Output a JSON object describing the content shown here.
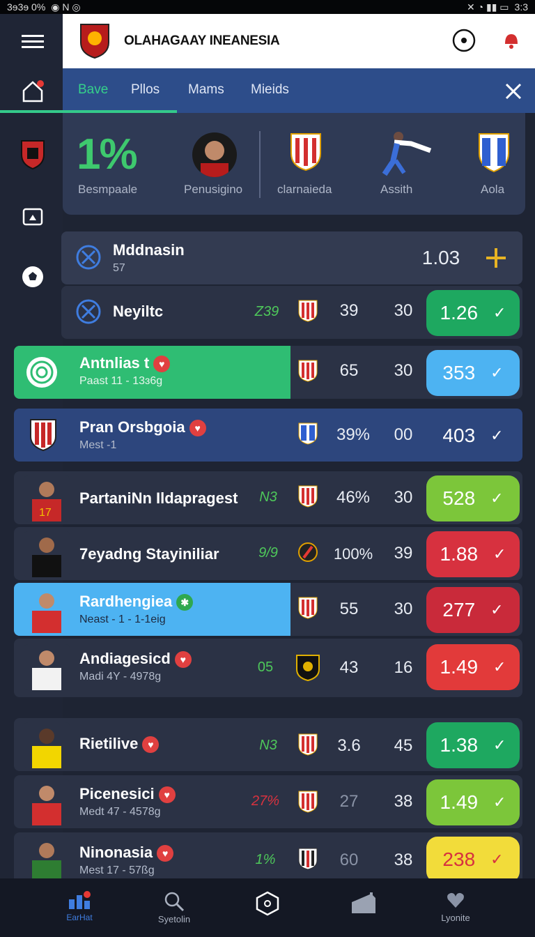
{
  "status_bar": {
    "left": "3ɘ3ɘ 0%",
    "right": "3:3"
  },
  "header": {
    "title": "OLAHAGAAY INEANESIA"
  },
  "tabs": [
    "Bave",
    "Pllos",
    "Mams",
    "Mieids"
  ],
  "featured": {
    "stat_value": "1%",
    "labels": [
      "Besmpaale",
      "Penusigino",
      "clarnaieda",
      "Assith",
      "Aola"
    ]
  },
  "rows": [
    {
      "name": "Mddnasin",
      "sub": "57",
      "col_odds": "1.03"
    },
    {
      "name": "Neyiltc",
      "small": "Z39",
      "c1": "39",
      "c2": "30",
      "pill": "1.26"
    },
    {
      "name": "Antnlias t",
      "sub": "Paast 11 - 13ɜ6g",
      "c1": "65",
      "c2": "30",
      "pill": "353"
    },
    {
      "name": "Pran Orsbgoia",
      "sub": "Mest -1",
      "c1": "39%",
      "c2": "00",
      "pill": "403"
    },
    {
      "name": "PartaniNn Ildapragest",
      "small": "N3",
      "c1": "46%",
      "c2": "30",
      "pill": "528"
    },
    {
      "name": "7eyadng Stayiniliar",
      "small": "9/9",
      "c1": "100%",
      "c2": "39",
      "pill": "1.88"
    },
    {
      "name": "Rardhengiea",
      "sub": "Neast - 1 - 1-1eig",
      "c1": "55",
      "c2": "30",
      "pill": "277"
    },
    {
      "name": "Andiagesicd",
      "sub": "Madi 4Y - 4978g",
      "small": "05",
      "c1": "43",
      "c2": "16",
      "pill": "1.49"
    },
    {
      "name": "Rietilive",
      "small": "N3",
      "c1": "3.6",
      "c2": "45",
      "pill": "1.38"
    },
    {
      "name": "Picenesici",
      "sub": "Medt 47 - 4578g",
      "small": "27%",
      "c1": "27",
      "c2": "38",
      "pill": "1.49"
    },
    {
      "name": "Ninonasia",
      "sub": "Mest 17 - 57ßg",
      "small": "1%",
      "c1": "60",
      "c2": "38",
      "pill": "238"
    }
  ],
  "bottom_nav": [
    "EarHat",
    "Syetolin",
    "",
    "",
    "Lyonite"
  ],
  "colors": {
    "accent_green": "#1ea860",
    "accent_blue": "#4db3f2",
    "lime": "#7cc63a",
    "red": "#d7313f",
    "yellow": "#f2dc3a"
  }
}
